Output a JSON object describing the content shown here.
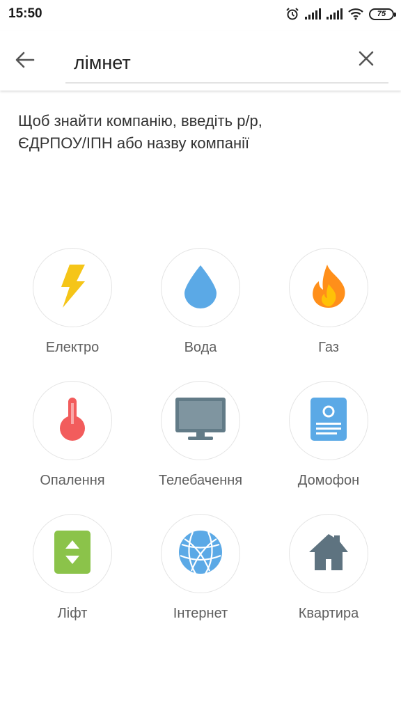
{
  "status_bar": {
    "time": "15:50",
    "battery": "75",
    "icons": [
      "alarm-icon",
      "signal-icon",
      "signal-icon",
      "wifi-icon",
      "battery-icon"
    ]
  },
  "search": {
    "value": "лімнет",
    "back_icon": "arrow-left-icon",
    "clear_icon": "close-icon"
  },
  "hint": "Щоб знайти компанію, введіть р/р,\nЄДРПОУ/ІПН або назву компанії",
  "categories": [
    {
      "label": "Електро",
      "icon": "lightning-icon",
      "color": "#F5C518"
    },
    {
      "label": "Вода",
      "icon": "water-drop-icon",
      "color": "#5BA9E6"
    },
    {
      "label": "Газ",
      "icon": "flame-icon",
      "color": "#FF8F1A"
    },
    {
      "label": "Опалення",
      "icon": "thermometer-icon",
      "color": "#F25C5C"
    },
    {
      "label": "Телебачення",
      "icon": "tv-icon",
      "color": "#627B87"
    },
    {
      "label": "Домофон",
      "icon": "intercom-icon",
      "color": "#5BA9E6"
    },
    {
      "label": "Ліфт",
      "icon": "elevator-icon",
      "color": "#8BC34A"
    },
    {
      "label": "Інтернет",
      "icon": "globe-icon",
      "color": "#5BA9E6"
    },
    {
      "label": "Квартира",
      "icon": "house-icon",
      "color": "#5E7380"
    }
  ]
}
